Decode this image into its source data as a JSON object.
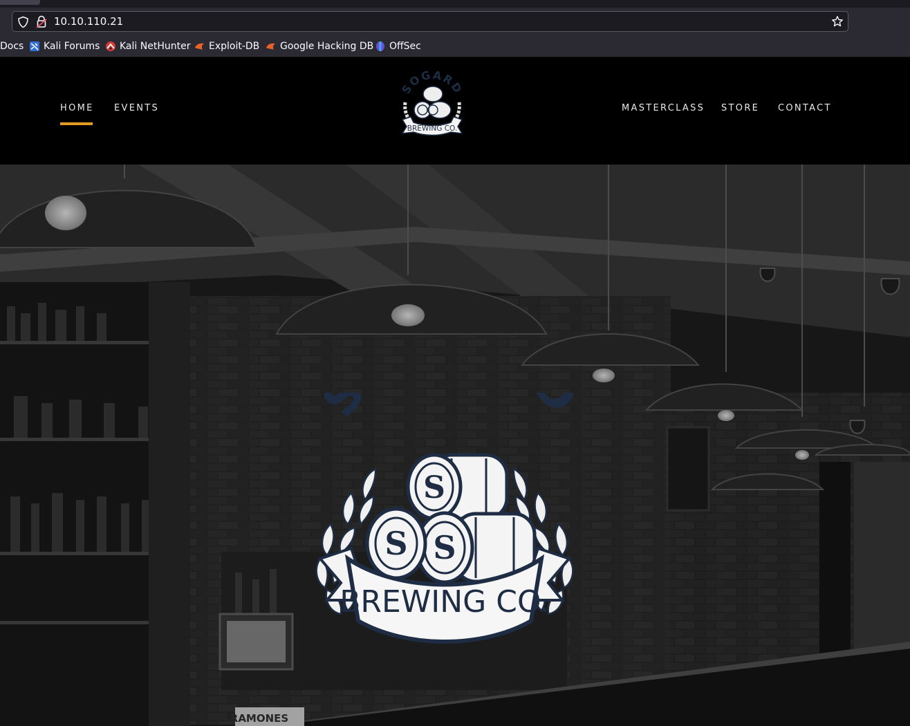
{
  "browser": {
    "url": "10.10.110.21",
    "icons": {
      "shield": "shield-icon",
      "lock": "lock-warning-icon",
      "star": "bookmark-star-icon"
    },
    "bookmarks": [
      {
        "label": "Docs",
        "icon": ""
      },
      {
        "label": "Kali Forums",
        "icon": "kali-icon"
      },
      {
        "label": "Kali NetHunter",
        "icon": "nethunter-icon"
      },
      {
        "label": "Exploit-DB",
        "icon": "exploitdb-icon"
      },
      {
        "label": "Google Hacking DB",
        "icon": "ghdb-icon"
      },
      {
        "label": "OffSec",
        "icon": "offsec-icon"
      }
    ]
  },
  "nav": {
    "left": [
      "HOME",
      "EVENTS"
    ],
    "right": [
      "MASTERCLASS",
      "STORE",
      "CONTACT"
    ],
    "active": "HOME",
    "accent_color": "#e49a24"
  },
  "brand": {
    "top_text": "SOGARD",
    "banner_text": "BREWING CO.",
    "logo_color": "#1e2d44"
  }
}
